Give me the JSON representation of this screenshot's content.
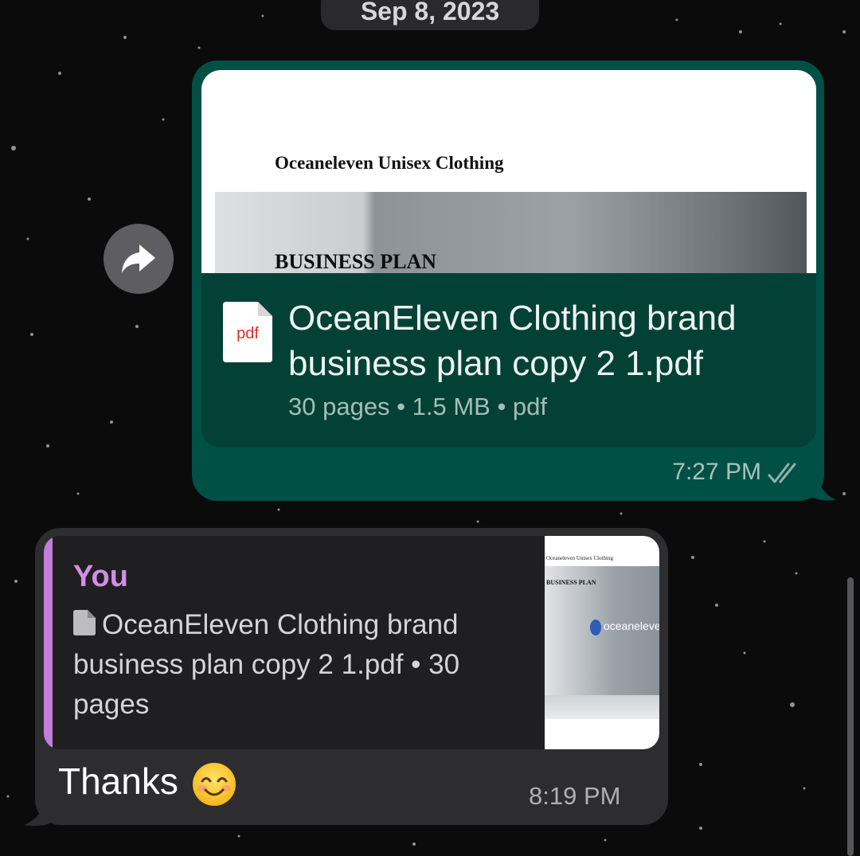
{
  "date_separator": "Sep 8, 2023",
  "forwarded_document": {
    "preview": {
      "title": "Oceaneleven Unisex Clothing",
      "heading": "BUSINESS PLAN"
    },
    "icon_label": "pdf",
    "file_name": "OceanEleven Clothing brand business plan copy 2 1.pdf",
    "meta": "30 pages • 1.5 MB • pdf",
    "time": "7:27 PM",
    "status": "read"
  },
  "reply_message": {
    "quoted_author": "You",
    "quoted_text": "OceanEleven Clothing brand business plan copy 2 1.pdf • 30 pages",
    "thumbnail": {
      "title": "Oceaneleven Unisex Clothing",
      "heading": "BUSINESS PLAN",
      "logo_text": "oceaneleven"
    },
    "message": "Thanks",
    "emoji_name": "smiling-face-with-smiling-eyes",
    "time": "8:19 PM"
  },
  "colors": {
    "outgoing_bubble": "#005046",
    "incoming_bubble": "#2d2d2f",
    "reply_accent": "#c27ed8",
    "background": "#0b0b0c"
  }
}
